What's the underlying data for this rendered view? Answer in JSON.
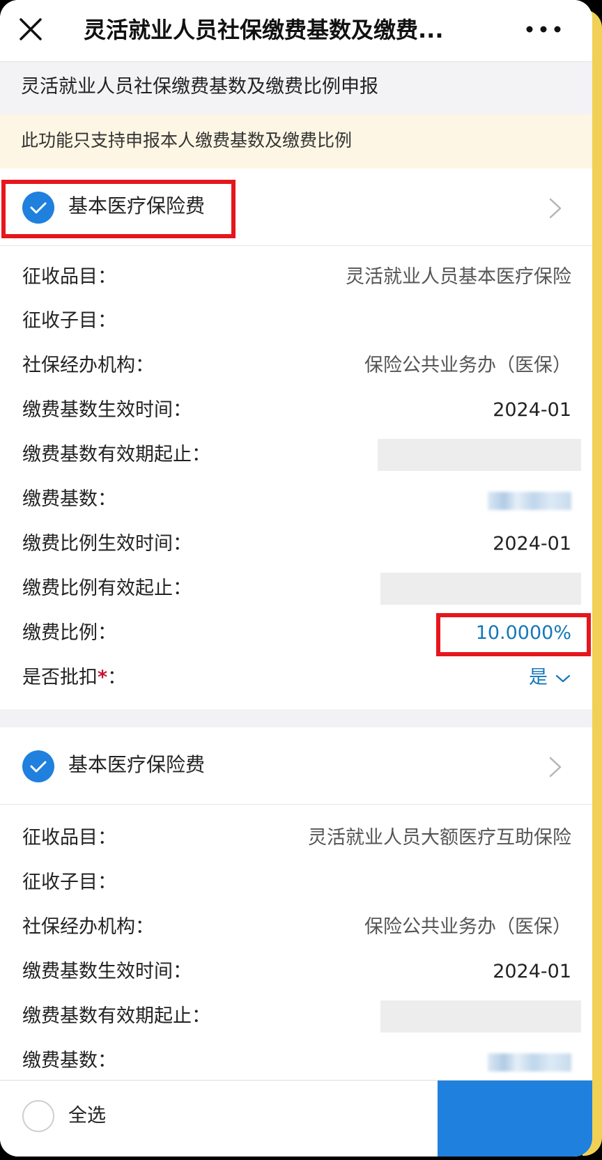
{
  "window": {
    "title": "灵活就业人员社保缴费基数及缴费...",
    "close_icon": "close-icon",
    "more_icon": "more-icon"
  },
  "header": {
    "title": "灵活就业人员社保缴费基数及缴费比例申报"
  },
  "notice": {
    "text": "此功能只支持申报本人缴费基数及缴费比例"
  },
  "sections": [
    {
      "title": "基本医疗保险费",
      "checked": true,
      "fields": [
        {
          "label": "征收品目：",
          "value": "灵活就业人员基本医疗保险"
        },
        {
          "label": "征收子目：",
          "value": ""
        },
        {
          "label": "社保经办机构：",
          "value": "保险公共业务办（医保）"
        },
        {
          "label": "缴费基数生效时间：",
          "value": "2024-01"
        },
        {
          "label": "缴费基数有效期起止：",
          "value": ""
        },
        {
          "label": "缴费基数：",
          "value": ""
        },
        {
          "label": "缴费比例生效时间：",
          "value": "2024-01"
        },
        {
          "label": "缴费比例有效起止：",
          "value": ""
        },
        {
          "label": "缴费比例：",
          "value": "10.0000%"
        },
        {
          "label": "是否批扣",
          "label_suffix": "：",
          "required_mark": "*",
          "value": "是"
        }
      ]
    },
    {
      "title": "基本医疗保险费",
      "checked": true,
      "fields": [
        {
          "label": "征收品目：",
          "value": "灵活就业人员大额医疗互助保险"
        },
        {
          "label": "征收子目：",
          "value": ""
        },
        {
          "label": "社保经办机构：",
          "value": "保险公共业务办（医保）"
        },
        {
          "label": "缴费基数生效时间：",
          "value": "2024-01"
        },
        {
          "label": "缴费基数有效期起止：",
          "value": ""
        },
        {
          "label": "缴费基数：",
          "value": ""
        }
      ]
    }
  ],
  "footer": {
    "select_all_label": "全选",
    "submit_label": ""
  },
  "colors": {
    "accent": "#1f80de",
    "highlight": "#e5161c",
    "notice_bg": "#fdf6e4",
    "value_blue": "#1677b8"
  }
}
